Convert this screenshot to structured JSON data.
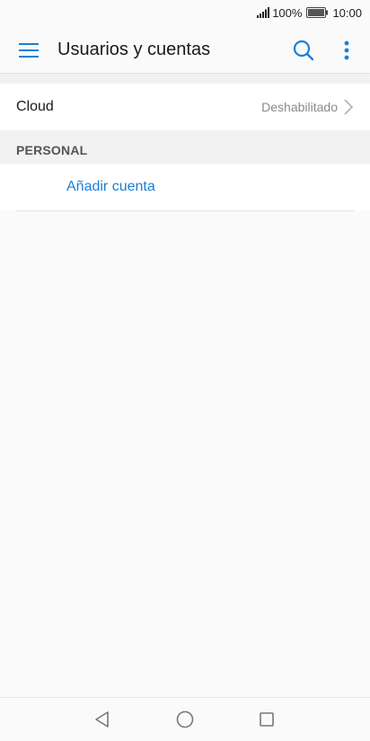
{
  "status_bar": {
    "battery": "100%",
    "time": "10:00"
  },
  "app_bar": {
    "title": "Usuarios y cuentas"
  },
  "cloud": {
    "label": "Cloud",
    "value": "Deshabilitado"
  },
  "personal": {
    "header": "PERSONAL",
    "add_account": "Añadir cuenta"
  },
  "colors": {
    "accent": "#1a7fd6",
    "background": "#fafafa",
    "section": "#f2f2f2"
  },
  "icons": {
    "menu": "hamburger-menu-icon",
    "search": "search-icon",
    "more": "more-vertical-icon",
    "back": "back-triangle-icon",
    "home": "home-circle-icon",
    "recent": "recent-square-icon"
  }
}
